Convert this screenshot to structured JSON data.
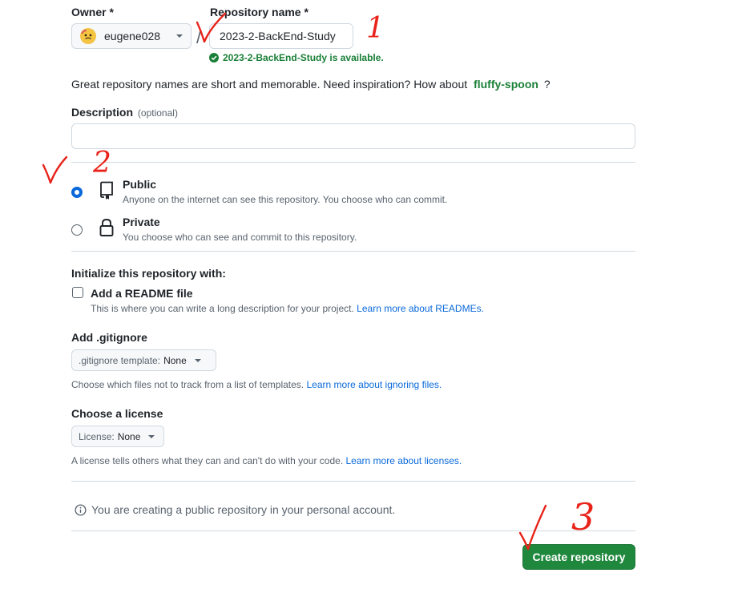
{
  "owner": {
    "label": "Owner *",
    "value": "eugene028",
    "avatar_icon": "avatar-emoji-icon"
  },
  "separator": "/",
  "repo": {
    "label": "Repository name *",
    "value": "2023-2-BackEnd-Study",
    "availability": "2023-2-BackEnd-Study is available."
  },
  "inspiration": {
    "text": "Great repository names are short and memorable. Need inspiration? How about",
    "suggestion": "fluffy-spoon",
    "suffix": "?"
  },
  "description": {
    "label": "Description",
    "optional": "(optional)",
    "value": ""
  },
  "visibility": {
    "public": {
      "title": "Public",
      "desc": "Anyone on the internet can see this repository. You choose who can commit.",
      "selected": true
    },
    "private": {
      "title": "Private",
      "desc": "You choose who can see and commit to this repository.",
      "selected": false
    }
  },
  "init": {
    "heading": "Initialize this repository with:",
    "readme_label": "Add a README file",
    "readme_desc": "This is where you can write a long description for your project.",
    "readme_link": "Learn more about READMEs.",
    "readme_checked": false
  },
  "gitignore": {
    "heading": "Add .gitignore",
    "select_prefix": ".gitignore template:",
    "select_value": "None",
    "desc": "Choose which files not to track from a list of templates.",
    "link": "Learn more about ignoring files."
  },
  "license": {
    "heading": "Choose a license",
    "select_prefix": "License:",
    "select_value": "None",
    "desc": "A license tells others what they can and can't do with your code.",
    "link": "Learn more about licenses."
  },
  "notice": "You are creating a public repository in your personal account.",
  "create_button": "Create repository",
  "annotations": {
    "one": "1",
    "two": "2",
    "three": "3"
  },
  "colors": {
    "accent_blue": "#0969da",
    "success_green": "#1a7f37",
    "button_green": "#1f883d",
    "annotation_red": "#e8231a"
  }
}
